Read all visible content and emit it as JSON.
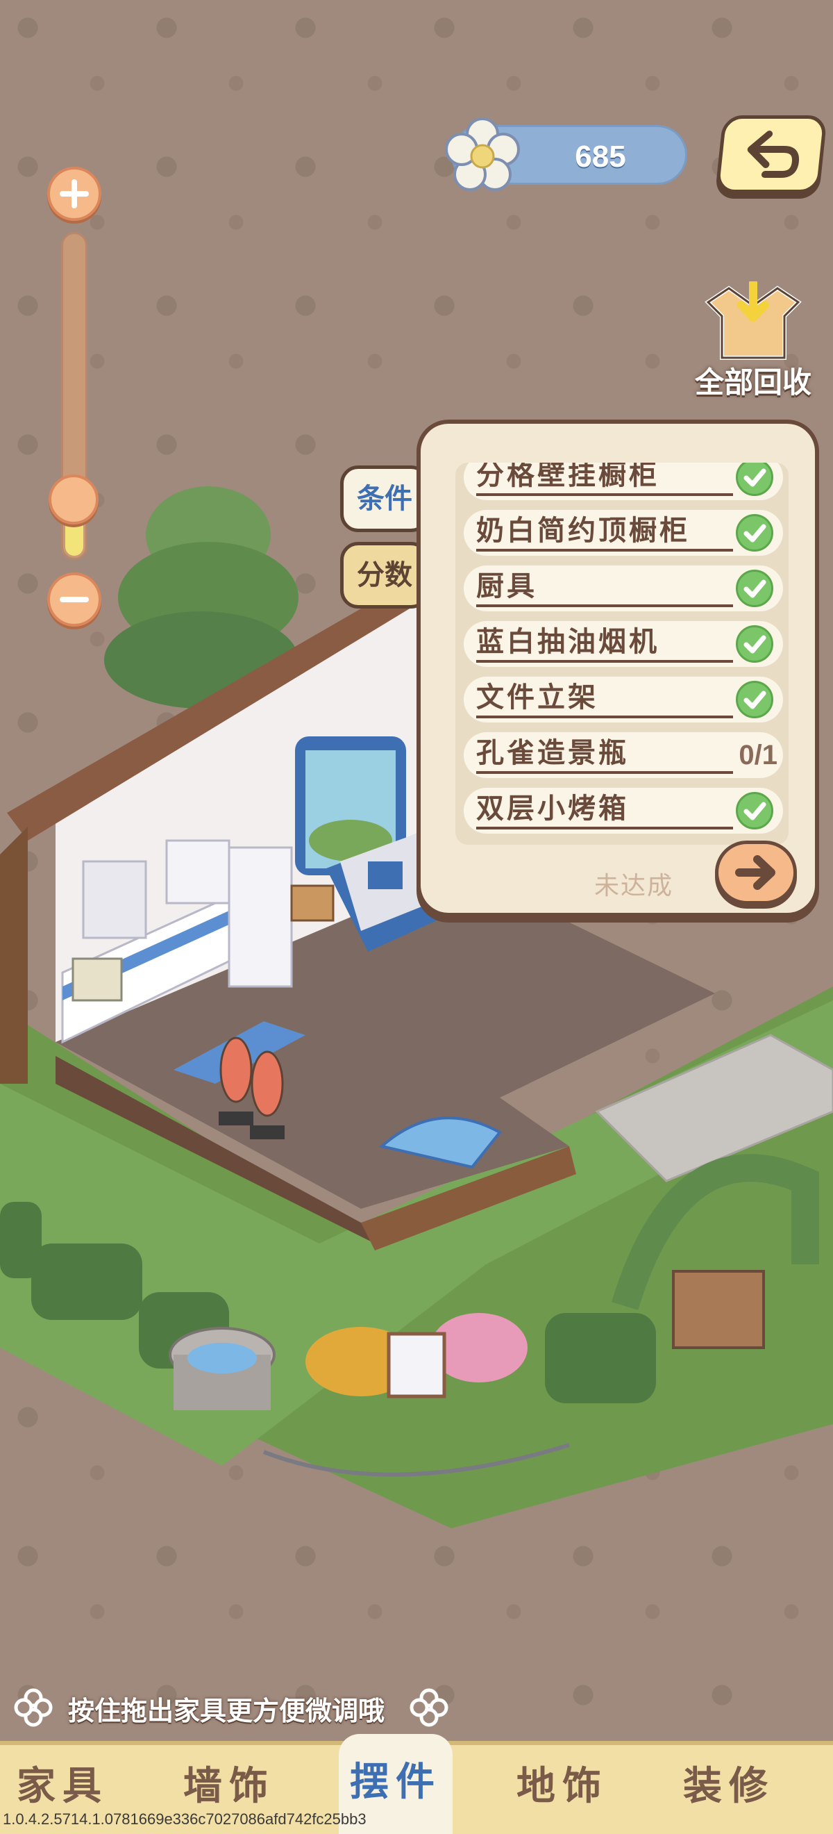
{
  "currency": {
    "value": "685",
    "icon": "flower-icon"
  },
  "actions": {
    "recycle_all": "全部回收"
  },
  "zoom": {
    "level": 0.12
  },
  "quest_panel": {
    "tabs": [
      {
        "label": "条件",
        "active": true
      },
      {
        "label": "分数",
        "active": false
      }
    ],
    "items": [
      {
        "name": "分格壁挂橱柜",
        "done": true,
        "progress": ""
      },
      {
        "name": "奶白简约顶橱柜",
        "done": true,
        "progress": ""
      },
      {
        "name": "厨具",
        "done": true,
        "progress": ""
      },
      {
        "name": "蓝白抽油烟机",
        "done": true,
        "progress": ""
      },
      {
        "name": "文件立架",
        "done": true,
        "progress": ""
      },
      {
        "name": "孔雀造景瓶",
        "done": false,
        "progress": "0/1"
      },
      {
        "name": "双层小烤箱",
        "done": true,
        "progress": ""
      }
    ],
    "status": "未达成"
  },
  "hint": "按住拖出家具更方便微调哦",
  "nav": {
    "items": [
      {
        "label": "家具",
        "active": false
      },
      {
        "label": "墙饰",
        "active": false
      },
      {
        "label": "摆件",
        "active": true
      },
      {
        "label": "地饰",
        "active": false
      },
      {
        "label": "装修",
        "active": false
      }
    ]
  },
  "build_version": "1.0.4.2.5714.1.0781669e336c7027086afd742fc25bb3",
  "colors": {
    "accent_blue": "#3f6fb3",
    "panel_border": "#6a4a3a",
    "check_green": "#7cc66a",
    "currency_bg": "#8fb0d4"
  }
}
